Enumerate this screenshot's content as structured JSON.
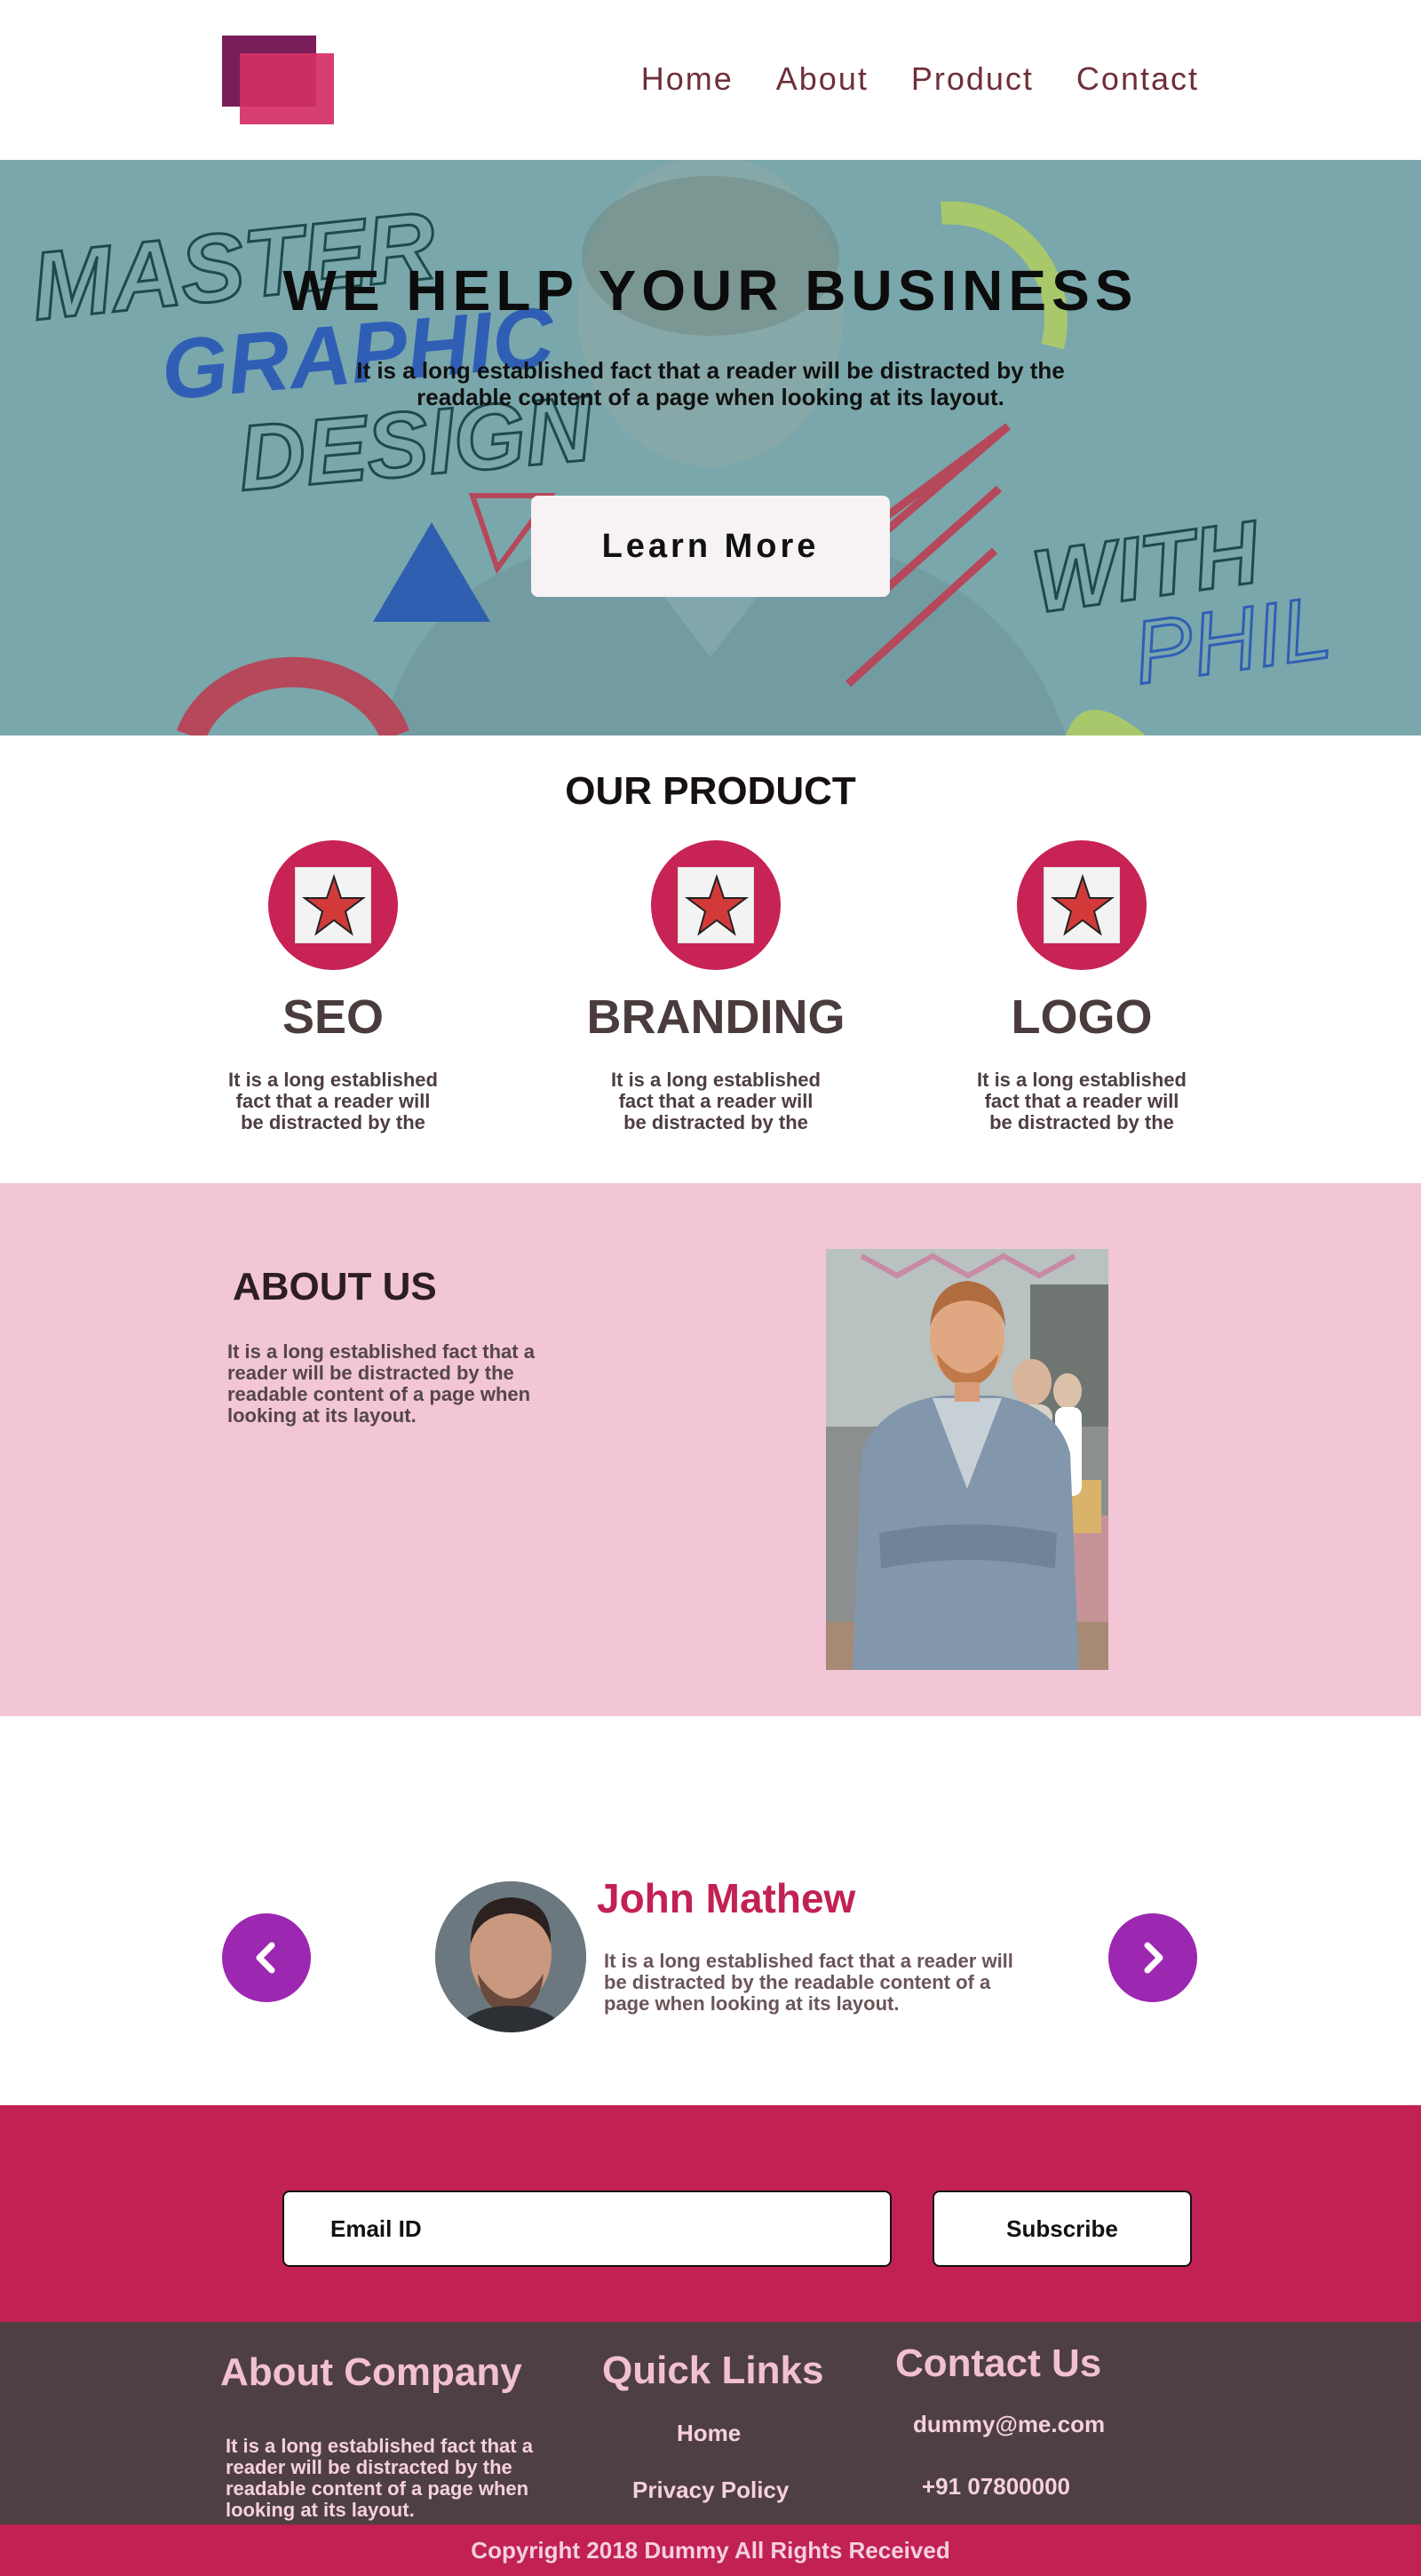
{
  "header": {
    "logo_icon": "logo-squares",
    "nav": [
      "Home",
      "About",
      "Product",
      "Contact"
    ]
  },
  "hero": {
    "title": "WE HELP YOUR BUSINESS",
    "subtitle": "It is a long established fact that a reader will be distracted by the readable content of a page when looking at its layout.",
    "button": "Learn More",
    "graphic_words": {
      "master": "MASTER",
      "graphic": "GRAPHIC",
      "design": "DESIGN",
      "with": "WITH",
      "phil": "PHIL"
    },
    "bg_color": "#7aa7ab"
  },
  "products": {
    "title": "OUR PRODUCT",
    "icon": "star-icon",
    "items": [
      {
        "name": "SEO",
        "desc": "It is a long established fact that a reader will be distracted by the"
      },
      {
        "name": "BRANDING",
        "desc": "It is a long established fact that a reader will be distracted by the"
      },
      {
        "name": "LOGO",
        "desc": "It is a long established fact that a reader will be distracted by the"
      }
    ]
  },
  "about": {
    "title": "ABOUT US",
    "text": "It is a long established fact that a reader will be distracted by the readable content of a page when looking at its layout.",
    "bg_color": "#f2c6d6"
  },
  "testimonial": {
    "name": "John Mathew",
    "text": "It is a long established fact that a reader will be distracted by the readable content of a page when looking at its layout.",
    "prev_icon": "chevron-left-icon",
    "next_icon": "chevron-right-icon",
    "accent": "#9c27b0"
  },
  "subscribe": {
    "email_placeholder": "Email ID",
    "button": "Subscribe",
    "bg_color": "#c22153"
  },
  "footer": {
    "about_title": "About Company",
    "about_text": "It is a long established fact that a reader will be distracted by the readable content of a page when looking at its layout.",
    "links_title": "Quick Links",
    "links": [
      "Home",
      "Privacy Policy"
    ],
    "contact_title": "Contact Us",
    "email": "dummy@me.com",
    "phone": "+91 07800000",
    "copyright": "Copyright 2018 Dummy All Rights Received"
  }
}
